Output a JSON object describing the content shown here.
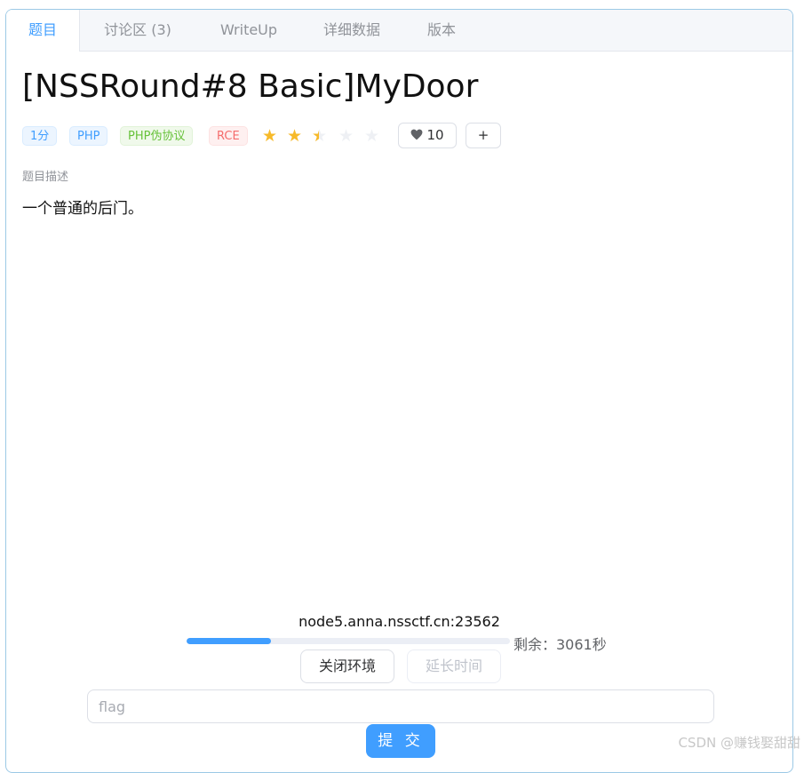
{
  "tabs": [
    {
      "label": "题目",
      "active": true
    },
    {
      "label": "讨论区 (3)",
      "active": false
    },
    {
      "label": "WriteUp",
      "active": false
    },
    {
      "label": "详细数据",
      "active": false
    },
    {
      "label": "版本",
      "active": false
    }
  ],
  "problem": {
    "title": "[NSSRound#8 Basic]MyDoor",
    "tags": [
      "1分",
      "PHP",
      "PHP伪协议",
      "RCE"
    ],
    "rating": 2.5,
    "rating_max": 5,
    "likes": "10",
    "add_label": "+",
    "description_label": "题目描述",
    "description": "一个普通的后门。"
  },
  "env": {
    "host": "node5.anna.nssctf.cn:23562",
    "progress": 0.26,
    "remaining_text": "剩余：3061秒",
    "close_label": "关闭环境",
    "extend_label": "延长时间"
  },
  "flag": {
    "placeholder": "flag",
    "value": "",
    "submit_label": "提 交"
  },
  "watermark": "CSDN @赚钱娶甜甜",
  "colors": {
    "accent": "#409eff",
    "star": "#f7ba2a",
    "tag_green": "#67c23a",
    "tag_red": "#f56c6c"
  }
}
